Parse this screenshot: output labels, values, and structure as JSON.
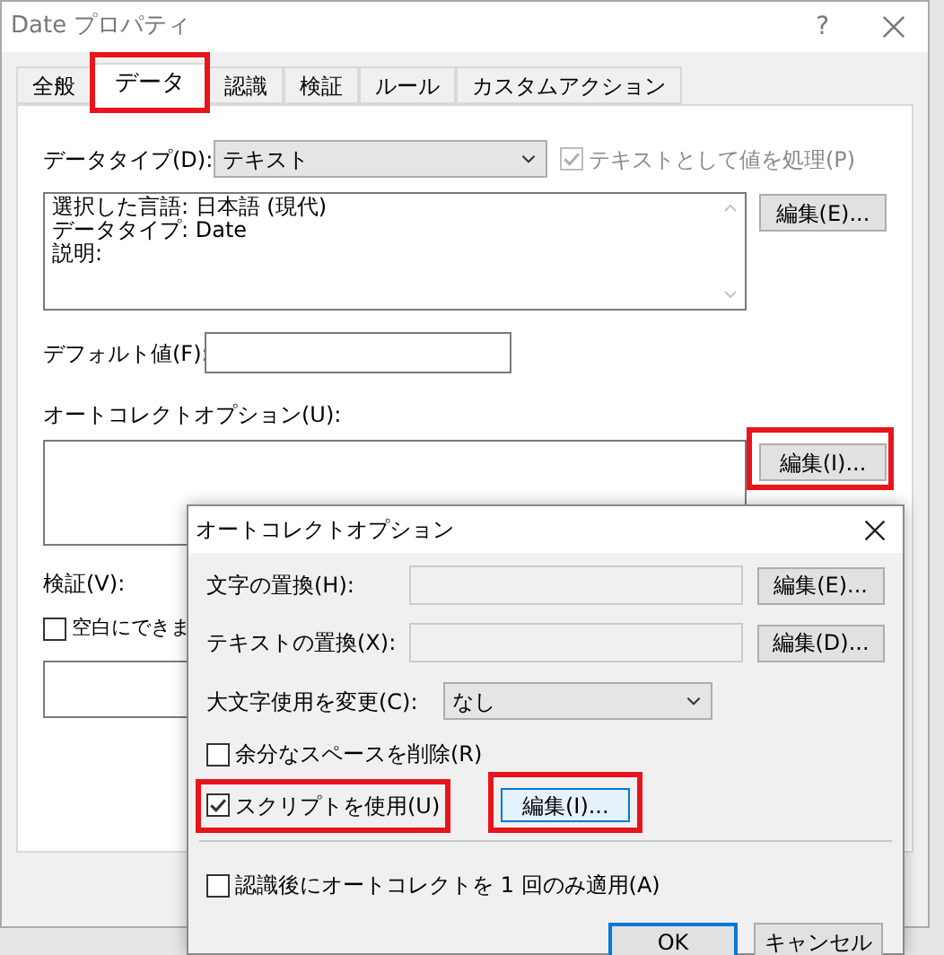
{
  "window": {
    "title": "Date プロパティ",
    "help_button": "?"
  },
  "tabs": [
    {
      "label": "全般",
      "selected": false,
      "highlighted": false
    },
    {
      "label": "データ",
      "selected": true,
      "highlighted": true
    },
    {
      "label": "認識",
      "selected": false,
      "highlighted": false
    },
    {
      "label": "検証",
      "selected": false,
      "highlighted": false
    },
    {
      "label": "ルール",
      "selected": false,
      "highlighted": false
    },
    {
      "label": "カスタムアクション",
      "selected": false,
      "highlighted": false
    }
  ],
  "data_type": {
    "label": "データタイプ(D):",
    "value": "テキスト"
  },
  "treat_as_text": {
    "label": "テキストとして値を処理(P)",
    "checked": true,
    "disabled": true
  },
  "info_lines": [
    "選択した言語: 日本語 (現代)",
    "データタイプ: Date",
    "説明:"
  ],
  "info_edit_button": {
    "label": "編集(E)...",
    "highlighted": false
  },
  "default_value": {
    "label": "デフォルト値(F):"
  },
  "autocorrect": {
    "label": "オートコレクトオプション(U):",
    "edit_button": {
      "label": "編集(I)...",
      "highlighted": true
    }
  },
  "validation": {
    "label": "検証(V):",
    "allow_blank": {
      "label": "空白にできま",
      "checked": false
    }
  },
  "dialog": {
    "title": "オートコレクトオプション",
    "rows": [
      {
        "label": "文字の置換(H):",
        "button": "編集(E)..."
      },
      {
        "label": "テキストの置換(X):",
        "button": "編集(D)..."
      }
    ],
    "capitalization": {
      "label": "大文字使用を変更(C):",
      "value": "なし"
    },
    "checkboxes": [
      {
        "label": "余分なスペースを削除(R)",
        "checked": false,
        "highlighted": false
      },
      {
        "label": "スクリプトを使用(U)",
        "checked": true,
        "highlighted": true
      }
    ],
    "script_edit_button": {
      "label": "編集(I)...",
      "highlighted": true,
      "focused": true
    },
    "apply_once": {
      "label": "認識後にオートコレクトを 1 回のみ適用(A)",
      "checked": false
    },
    "buttons": [
      {
        "label": "OK",
        "default": true
      },
      {
        "label": "キャンセル",
        "default": false
      }
    ]
  }
}
